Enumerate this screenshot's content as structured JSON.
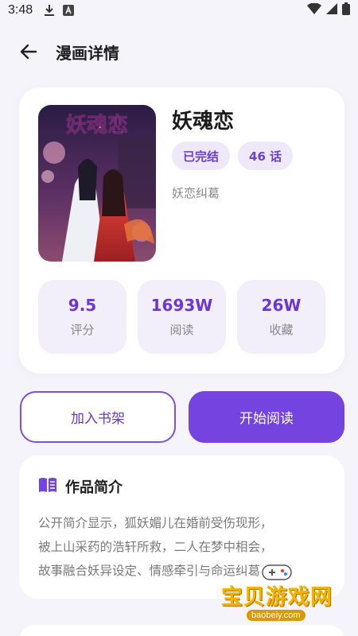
{
  "status_bar": {
    "time": "3:48"
  },
  "app_bar": {
    "title": "漫画详情"
  },
  "comic": {
    "title": "妖魂恋",
    "cover_text": "妖魂恋",
    "tags": [
      "已完结",
      "46 话"
    ],
    "genre": "妖恋纠葛",
    "stats": [
      {
        "value": "9.5",
        "label": "评分"
      },
      {
        "value": "1693W",
        "label": "阅读"
      },
      {
        "value": "26W",
        "label": "收藏"
      }
    ]
  },
  "actions": {
    "shelf_label": "加入书架",
    "read_label": "开始阅读"
  },
  "intro": {
    "title": "作品简介",
    "lines": [
      "公开简介显示，狐妖媚儿在婚前受伤现形，",
      "被上山采药的浩轩所救，二人在梦中相会，",
      "故事融合妖异设定、情感牵引与命运纠葛"
    ]
  },
  "watermark": {
    "brand": "宝贝游戏网",
    "url": "baobeiy.com"
  },
  "colors": {
    "accent": "#7443e0",
    "tag_bg": "#efe8fb",
    "page_bg": "#f5f4fa"
  }
}
